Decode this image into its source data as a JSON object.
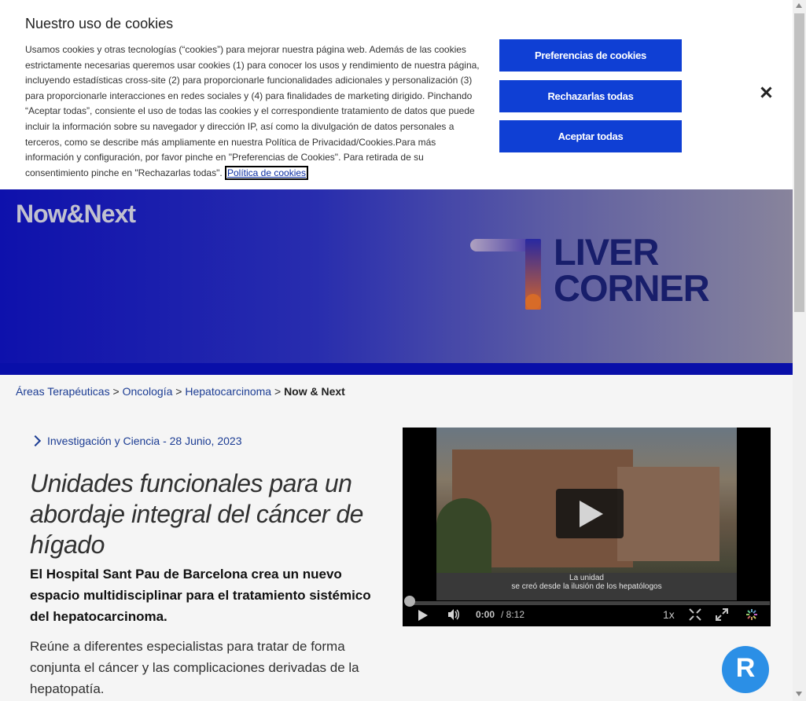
{
  "cookie": {
    "title": "Nuestro uso de cookies",
    "text": "Usamos cookies y otras tecnologías (“cookies”) para mejorar nuestra página web. Además de las cookies estrictamente necesarias queremos usar cookies (1) para conocer los usos y rendimiento de nuestra página, incluyendo estadísticas cross-site (2) para proporcionarle funcionalidades adicionales y personalización (3) para proporcionarle interacciones en redes sociales y (4) para finalidades de marketing dirigido. Pinchando “Aceptar todas”, consiente el uso de todas las cookies y el correspondiente tratamiento de datos que puede incluir la información sobre su navegador y dirección IP, así como la divulgación de datos personales a terceros, como se describe más ampliamente en nuestra Política de Privacidad/Cookies.Para más información y configuración, por favor pinche en \"Preferencias de Cookies\". Para retirada de su consentimiento pinche en \"Rechazarlas todas\". ",
    "policy_link": "Política de cookies",
    "btn_prefs": "Preferencias de cookies",
    "btn_reject": "Rechazarlas todas",
    "btn_accept": "Aceptar todas"
  },
  "hero": {
    "brand": "Now&Next",
    "logo_line1": "LIVER",
    "logo_line2": "CORNER"
  },
  "breadcrumb": {
    "items": [
      "Áreas Terapéuticas",
      "Oncología",
      "Hepatocarcinoma"
    ],
    "current": "Now & Next",
    "sep": ">"
  },
  "article": {
    "category": "Investigación y Ciencia - 28 Junio, 2023",
    "title": "Unidades funcionales para un abordaje integral del cáncer de hígado",
    "lead": "El Hospital Sant Pau de Barcelona crea un nuevo espacio multidisciplinar para el tratamiento sistémico del hepatocarcinoma.",
    "body": "Reúne a diferentes especialistas para tratar de forma conjunta el cáncer y las complicaciones derivadas de la hepatopatía."
  },
  "video": {
    "subtitle_line1": "La unidad",
    "subtitle_line2": "se creó desde la ilusión de los hepatólogos",
    "current_time": "0:00",
    "duration": "/ 8:12",
    "rate": "1x",
    "progress": 0
  },
  "fab": {
    "label": "R"
  },
  "colors": {
    "accent": "#0f3fd4",
    "hero": "#0f12b4",
    "link": "#1d3f9a"
  }
}
